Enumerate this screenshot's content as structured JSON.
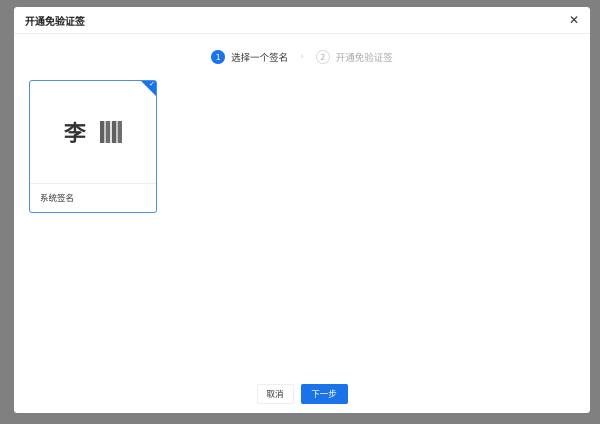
{
  "dialog": {
    "title": "开通免验证签",
    "close_icon": "close-icon"
  },
  "steps": [
    {
      "num": "1",
      "label": "选择一个签名"
    },
    {
      "num": "2",
      "label": "开通免验证签"
    }
  ],
  "card": {
    "signature_name": "李",
    "label": "系统签名",
    "selected": true
  },
  "footer": {
    "cancel": "取消",
    "next": "下一步"
  },
  "colors": {
    "accent": "#1a73e8"
  }
}
